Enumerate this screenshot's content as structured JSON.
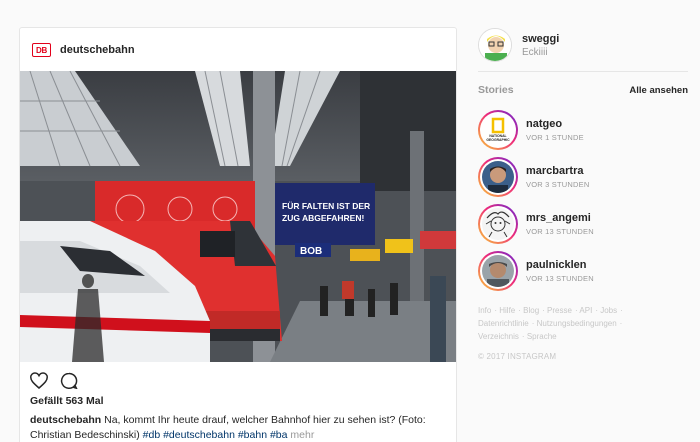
{
  "post": {
    "username": "deutschebahn",
    "logo_text": "DB",
    "likes": "Gefällt 563 Mal",
    "caption_user": "deutschebahn",
    "caption_text": " Na, kommt Ihr heute drauf, welcher Bahnhof hier zu sehen ist? (Foto: Christian Bedeschinski) ",
    "hashtags": [
      "#db",
      "#deutschebahn",
      "#bahn",
      "#ba"
    ],
    "more": "mehr",
    "photo_signs": {
      "banner": "FÜR FALTEN IST DER ZUG ABGEFAHREN!",
      "bob": "BOB"
    }
  },
  "sidebar": {
    "user": {
      "username": "sweggi",
      "fullname": "Eckiiii"
    },
    "stories_title": "Stories",
    "view_all": "Alle ansehen",
    "stories": [
      {
        "name": "natgeo",
        "time": "VOR 1 STUNDE",
        "avatar": "natgeo-logo-icon"
      },
      {
        "name": "marcbartra",
        "time": "VOR 3 STUNDEN",
        "avatar": "person-photo"
      },
      {
        "name": "mrs_angemi",
        "time": "VOR 13 STUNDEN",
        "avatar": "sketch-drawing"
      },
      {
        "name": "paulnicklen",
        "time": "VOR 13 STUNDEN",
        "avatar": "person-photo"
      }
    ],
    "footer_links": [
      "Info",
      "Hilfe",
      "Blog",
      "Presse",
      "API",
      "Jobs",
      "Datenrichtlinie",
      "Nutzungsbedingungen",
      "Verzeichnis",
      "Sprache"
    ],
    "copyright": "© 2017 INSTAGRAM"
  },
  "colors": {
    "db_red": "#e2001a",
    "link_blue": "#003569",
    "muted": "#999999"
  }
}
